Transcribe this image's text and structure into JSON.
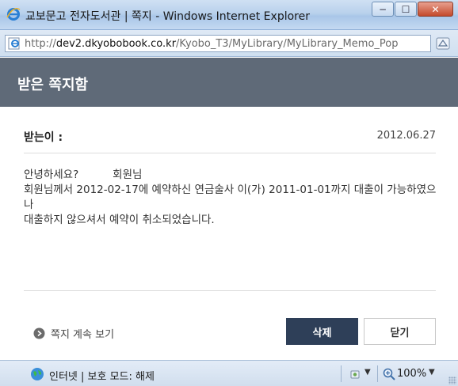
{
  "window": {
    "title": "교보문고 전자도서관 | 쪽지 - Windows Internet Explorer",
    "minimize_glyph": "−",
    "maximize_glyph": "☐",
    "close_glyph": "✕"
  },
  "address_bar": {
    "url_prefix": "http://",
    "url_host": "dev2.dkyobobook.co.kr",
    "url_path": "/Kyobo_T3/MyLibrary/MyLibrary_Memo_Pop"
  },
  "popup": {
    "title": "받은 쪽지함"
  },
  "message": {
    "recipient_label": "받는이 :",
    "date": "2012.06.27",
    "lines": [
      "안녕하세요?          회원님",
      "회원님께서 2012-02-17에 예약하신 연금술사 이(가) 2011-01-01까지 대출이 가능하였으나",
      "대출하지 않으셔서 예약이 취소되었습니다."
    ]
  },
  "actions": {
    "more_link": "쪽지 계속 보기",
    "delete_label": "삭제",
    "close_label": "닫기"
  },
  "status_bar": {
    "zone_text": "인터넷 | 보호 모드: 해제",
    "zoom": "100%"
  },
  "colors": {
    "header_bg": "#5f6a78",
    "delete_btn_bg": "#2e3f58"
  }
}
